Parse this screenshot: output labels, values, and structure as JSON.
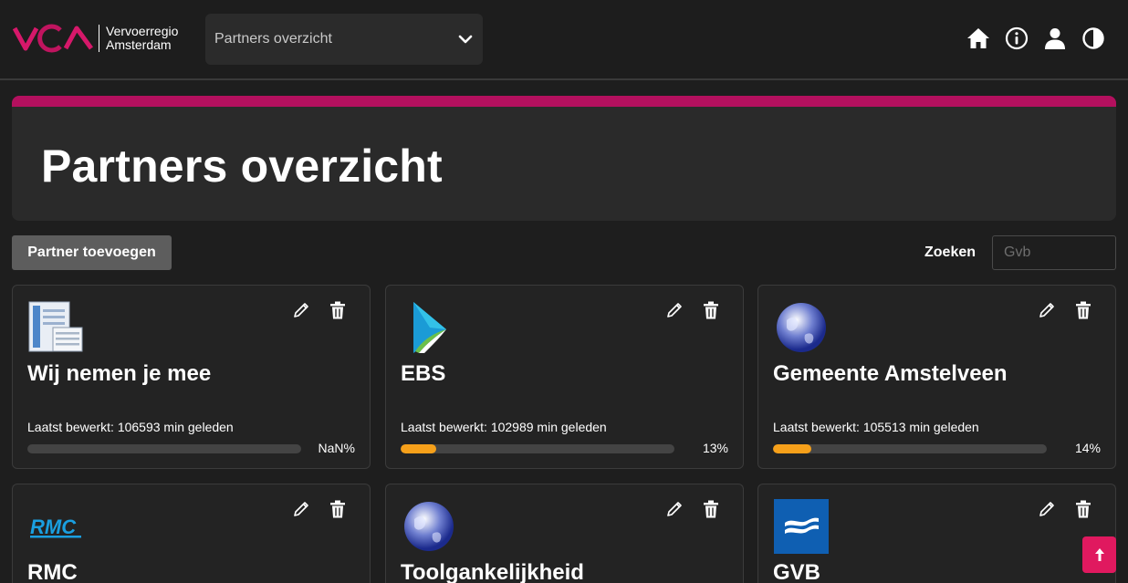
{
  "brand": {
    "logo_mark": "VRA",
    "name_line1": "Vervoerregio",
    "name_line2": "Amsterdam",
    "accent_color": "#b3105e"
  },
  "nav": {
    "selected_page": "Partners overzicht",
    "icons": [
      "home-icon",
      "info-icon",
      "user-icon",
      "contrast-icon"
    ]
  },
  "page": {
    "title": "Partners overzicht",
    "add_button_label": "Partner toevoegen",
    "search_label": "Zoeken",
    "search_placeholder": "Gvb"
  },
  "partners": [
    {
      "name": "Wij nemen je mee",
      "edited": "Laatst bewerkt: 106593 min geleden",
      "progress_label": "NaN%",
      "progress": 0,
      "logo": "document-icon"
    },
    {
      "name": "EBS",
      "edited": "Laatst bewerkt: 102989 min geleden",
      "progress_label": "13%",
      "progress": 0.13,
      "logo": "ebs-logo"
    },
    {
      "name": "Gemeente Amstelveen",
      "edited": "Laatst bewerkt: 105513 min geleden",
      "progress_label": "14%",
      "progress": 0.14,
      "logo": "globe-icon"
    },
    {
      "name": "RMC",
      "logo": "rmc-logo"
    },
    {
      "name": "Toolgankelijkheid",
      "logo": "globe-icon"
    },
    {
      "name": "GVB",
      "logo": "gvb-logo"
    }
  ],
  "colors": {
    "progress_fill": "#f6a01a",
    "scroll_button": "#e0195f"
  }
}
